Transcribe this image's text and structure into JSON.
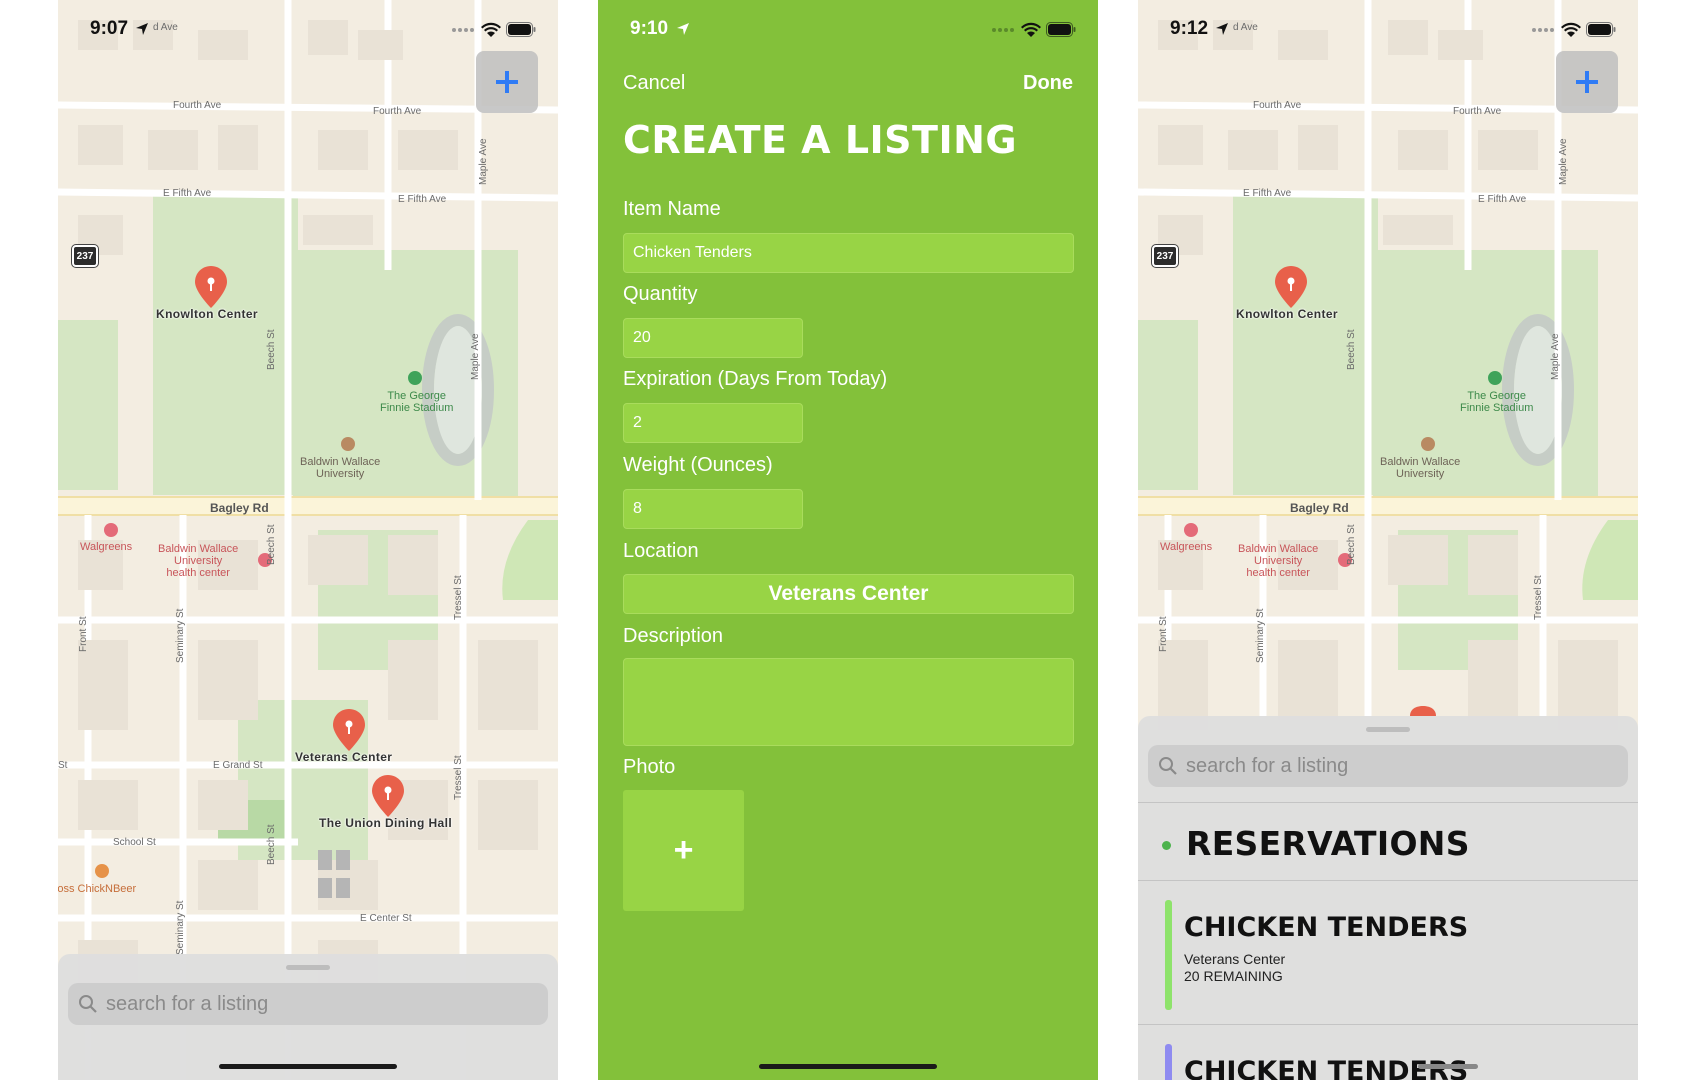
{
  "map_labels": {
    "fourth_ave": "Fourth Ave",
    "fifth_ave": "E Fifth Ave",
    "bagley_rd": "Bagley Rd",
    "beech_st": "Beech St",
    "maple_ave": "Maple Ave",
    "seminary_st": "Seminary St",
    "front_st": "Front St",
    "tressel_st": "Tressel St",
    "grand_st": "E Grand St",
    "school_st": "School St",
    "center_st": "E Center St",
    "top_ave": "d Ave",
    "route": "237",
    "stadium": "The George\nFinnie Stadium",
    "university": "Baldwin Wallace\nUniversity",
    "walgreens": "Walgreens",
    "health_center": "Baldwin Wallace\nUniversity\nhealth center",
    "chickenbeer": "Boss ChickNBeer",
    "st_fragment": "St"
  },
  "left_screen": {
    "time": "9:07",
    "pins": [
      {
        "label": "Knowlton Center"
      },
      {
        "label": "Veterans Center"
      },
      {
        "label": "The Union Dining Hall"
      }
    ],
    "add_icon": "plus-icon",
    "search_placeholder": "search for a listing"
  },
  "middle_screen": {
    "time": "9:10",
    "cancel_label": "Cancel",
    "done_label": "Done",
    "title": "CREATE A LISTING",
    "fields": {
      "item_name_label": "Item Name",
      "item_name_value": "Chicken Tenders",
      "quantity_label": "Quantity",
      "quantity_value": "20",
      "expiration_label": "Expiration (Days From Today)",
      "expiration_value": "2",
      "weight_label": "Weight (Ounces)",
      "weight_value": "8",
      "location_label": "Location",
      "location_value": "Veterans Center",
      "description_label": "Description",
      "description_value": "",
      "photo_label": "Photo",
      "photo_add": "+"
    },
    "colors": {
      "background": "#83c13a",
      "field": "#98d445"
    }
  },
  "right_screen": {
    "time": "9:12",
    "pins": [
      {
        "label": "Knowlton Center"
      }
    ],
    "search_placeholder": "search for a listing",
    "section_title": "RESERVATIONS",
    "reservations": [
      {
        "title": "CHICKEN TENDERS",
        "location": "Veterans Center",
        "remaining": "20 REMAINING",
        "bar_color": "#8ee36b"
      },
      {
        "title": "CHICKEN TENDERS",
        "bar_color": "#8f8bf0"
      }
    ]
  },
  "colors": {
    "pin": "#e8604a",
    "accent_blue": "#2f7bf5"
  }
}
